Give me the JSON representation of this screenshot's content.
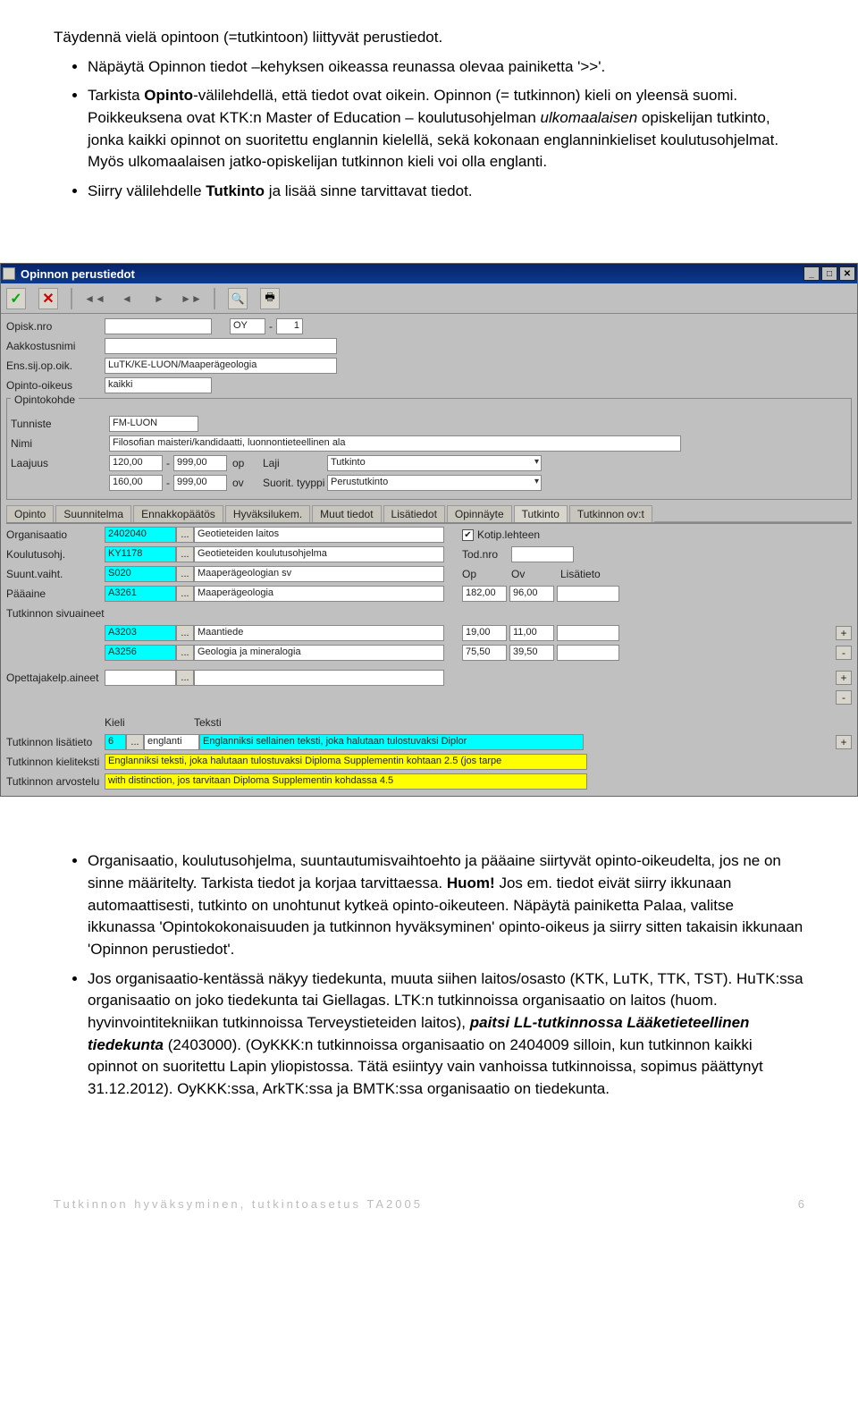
{
  "doc": {
    "p1": "Täydennä vielä opintoon (=tutkintoon) liittyvät perustiedot.",
    "li1a": "Näpäytä Opinnon tiedot –kehyksen oikeassa reunassa olevaa painiketta '>>'.",
    "li1b_a": "Tarkista ",
    "li1b_b": "Opinto",
    "li1b_c": "-välilehdellä, että tiedot ovat oikein. Opinnon (= tutkinnon) kieli on yleensä suomi. Poikkeuksena ovat KTK:n Master of Education – koulutusohjelman ",
    "li1b_d": "ulkomaalaisen",
    "li1b_e": " opiskelijan tutkinto, jonka kaikki opinnot on suoritettu englannin kielellä, sekä kokonaan englanninkieliset koulutusohjelmat. Myös ulkomaalaisen jatko-opiskelijan tutkinnon kieli voi olla englanti.",
    "li1c_a": "Siirry välilehdelle ",
    "li1c_b": "Tutkinto",
    "li1c_c": " ja lisää sinne tarvittavat tiedot.",
    "li2a_a": "Organisaatio, koulutusohjelma, suuntautumisvaihtoehto ja pääaine siirtyvät opinto-oikeudelta, jos ne on sinne määritelty. Tarkista tiedot ja korjaa tarvittaessa. ",
    "li2a_b": "Huom!",
    "li2a_c": " Jos em. tiedot eivät siirry ikkunaan automaattisesti, tutkinto on unohtunut kytkeä opinto-oikeuteen. Näpäytä painiketta Palaa, valitse ikkunassa 'Opintokokonaisuuden ja tutkinnon hyväksyminen' opinto-oikeus ja siirry sitten takaisin ikkunaan 'Opinnon perustiedot'.",
    "li2b_a": "Jos organisaatio-kentässä näkyy tiedekunta, muuta siihen laitos/osasto (KTK, LuTK, TTK, TST). HuTK:ssa organisaatio on joko tiedekunta tai Giellagas. LTK:n tutkinnoissa organisaatio on laitos (huom. hyvinvointitekniikan tutkinnoissa Terveystieteiden laitos), ",
    "li2b_b": "paitsi LL-tutkinnossa Lääketieteellinen tiedekunta",
    "li2b_c": " (2403000). (OyKKK:n tutkinnoissa organisaatio on 2404009 silloin, kun tutkinnon kaikki opinnot on suoritettu Lapin yliopistossa. Tätä esiintyy vain vanhoissa tutkinnoissa, sopimus päättynyt 31.12.2012). OyKKK:ssa, ArkTK:ssa ja BMTK:ssa organisaatio on tiedekunta."
  },
  "window": {
    "title": "Opinnon perustiedot",
    "toolbar": {
      "ok": "✓",
      "cancel": "✕",
      "search": "🔍",
      "print": "🖶"
    }
  },
  "header": {
    "labels": {
      "opisknro": "Opisk.nro",
      "aakk": "Aakkostusnimi",
      "ens": "Ens.sij.op.oik.",
      "opoik": "Opinto-oikeus"
    },
    "oy": "OY",
    "one": "1",
    "ens_val": "LuTK/KE-LUON/Maaperägeologia",
    "opoik_val": "kaikki"
  },
  "opintokohde": {
    "legend": "Opintokohde",
    "labels": {
      "tunniste": "Tunniste",
      "nimi": "Nimi",
      "laajuus": "Laajuus",
      "laji": "Laji",
      "suortyyppi": "Suorit. tyyppi",
      "op": "op",
      "ov": "ov"
    },
    "tunniste": "FM-LUON",
    "nimi": "Filosofian maisteri/kandidaatti, luonnontieteellinen ala",
    "laaj1a": "120,00",
    "laaj1b": "999,00",
    "laaj2a": "160,00",
    "laaj2b": "999,00",
    "laji": "Tutkinto",
    "styyppi": "Perustutkinto"
  },
  "tabs": [
    "Opinto",
    "Suunnitelma",
    "Ennakkopäätös",
    "Hyväksilukem.",
    "Muut tiedot",
    "Lisätiedot",
    "Opinnäyte",
    "Tutkinto",
    "Tutkinnon ov:t"
  ],
  "tutkinto": {
    "labels": {
      "org": "Organisaatio",
      "kohj": "Koulutusohj.",
      "suunt": "Suunt.vaiht.",
      "paa": "Pääaine",
      "sivu": "Tutkinnon sivuaineet",
      "opett": "Opettajakelp.aineet",
      "kieli": "Kieli",
      "teksti": "Teksti",
      "lisatieto_lbl": "Tutkinnon lisätieto",
      "kieliteksti_lbl": "Tutkinnon kieliteksti",
      "arvostelu_lbl": "Tutkinnon arvostelu",
      "kotip": "Kotip.lehteen",
      "todnro": "Tod.nro",
      "op": "Op",
      "ov": "Ov",
      "lisat": "Lisätieto"
    },
    "org_code": "2402040",
    "org_name": "Geotieteiden laitos",
    "kohj_code": "KY1178",
    "kohj_name": "Geotieteiden koulutusohjelma",
    "suunt_code": "S020",
    "suunt_name": "Maaperägeologian sv",
    "paa_code": "A3261",
    "paa_name": "Maaperägeologia",
    "paa_op": "182,00",
    "paa_ov": "96,00",
    "sivu1_code": "A3203",
    "sivu1_name": "Maantiede",
    "sivu1_op": "19,00",
    "sivu1_ov": "11,00",
    "sivu2_code": "A3256",
    "sivu2_name": "Geologia ja mineralogia",
    "sivu2_op": "75,50",
    "sivu2_ov": "39,50",
    "kieli_num": "6",
    "kieli_name": "englanti",
    "lisatieto_txt": "Englanniksi sellainen teksti, joka halutaan tulostuvaksi Diplor",
    "kieliteksti_txt": "Englanniksi teksti, joka halutaan tulostuvaksi Diploma Supplementin kohtaan 2.5 (jos tarpe",
    "arvostelu_txt": "with distinction, jos tarvitaan Diploma Supplementin kohdassa 4.5",
    "kotip_chk": "✔"
  },
  "footer": {
    "left": "Tutkinnon hyväksyminen, tutkintoasetus TA2005",
    "right": "6"
  }
}
